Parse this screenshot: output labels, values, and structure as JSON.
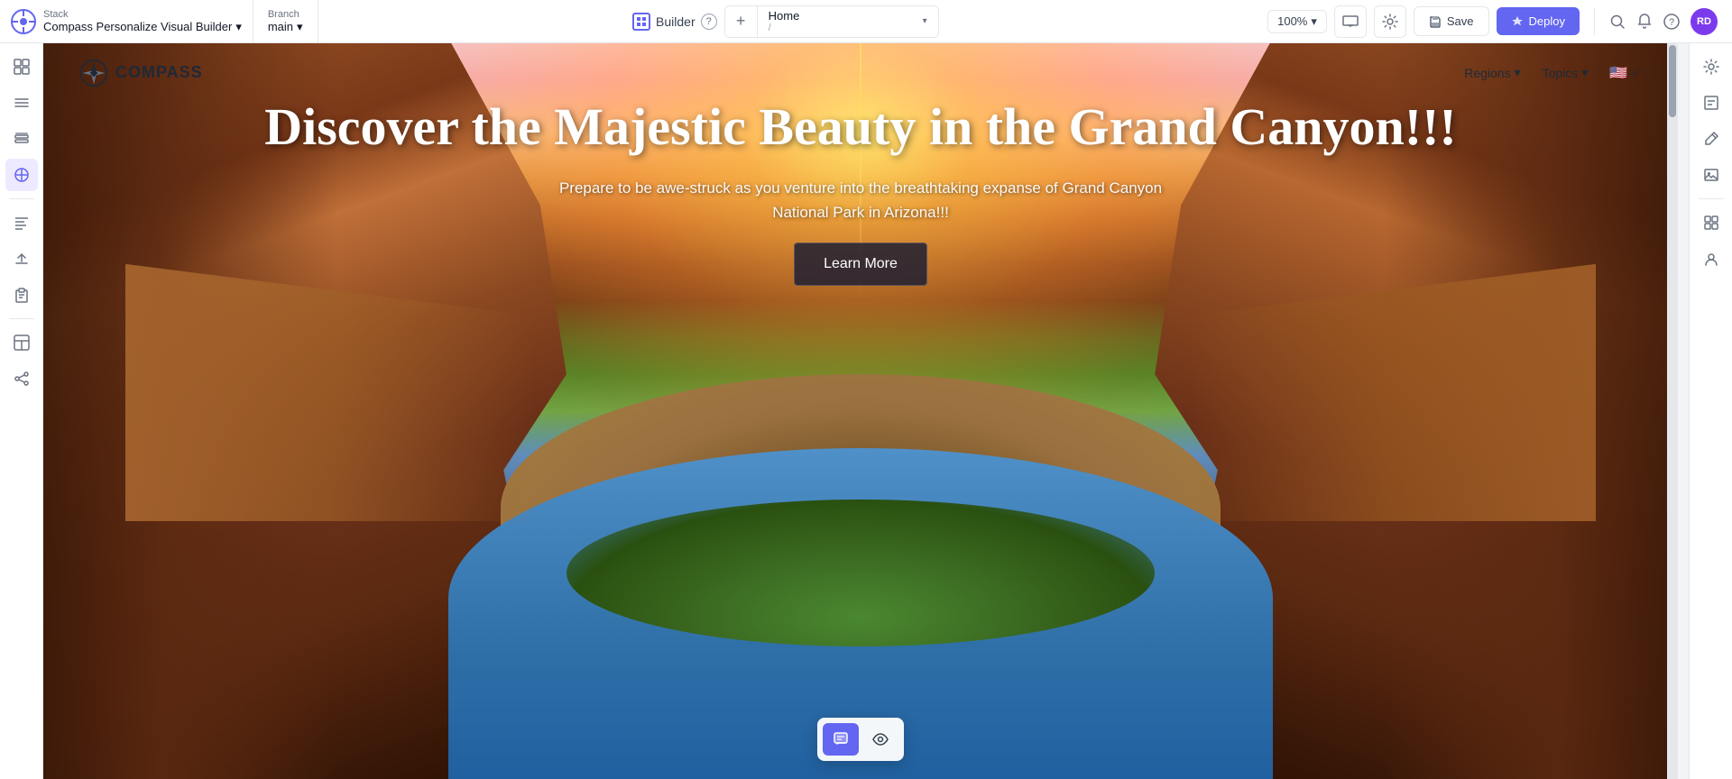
{
  "app": {
    "stack_label": "Stack",
    "stack_name": "Compass Personalize Visual Builder",
    "branch_label": "Branch",
    "branch_name": "main"
  },
  "topbar": {
    "builder_label": "Builder",
    "help_tooltip": "Help",
    "zoom_level": "100%",
    "save_label": "Save",
    "deploy_label": "Deploy",
    "avatar_initials": "RD"
  },
  "page_selector": {
    "add_label": "+",
    "page_name": "Home",
    "page_path": "/"
  },
  "site_nav": {
    "logo_text": "COMPASS",
    "regions_label": "Regions",
    "topics_label": "Topics",
    "flag_emoji": "🇺🇸"
  },
  "hero": {
    "title": "Discover the Majestic Beauty in the Grand Canyon!!!",
    "subtitle": "Prepare to be awe-struck as you venture into the breathtaking expanse of Grand Canyon National Park in Arizona!!!",
    "cta_label": "Learn More"
  },
  "left_sidebar": {
    "items": [
      {
        "name": "grid-icon",
        "symbol": "⊞",
        "active": false
      },
      {
        "name": "list-icon",
        "symbol": "≡",
        "active": false
      },
      {
        "name": "layers-icon",
        "symbol": "◧",
        "active": false
      },
      {
        "name": "components-icon",
        "symbol": "⊕",
        "active": true
      },
      {
        "name": "lines-icon",
        "symbol": "≣",
        "active": false
      },
      {
        "name": "upload-icon",
        "symbol": "↑",
        "active": false
      },
      {
        "name": "clipboard-icon",
        "symbol": "📋",
        "active": false
      },
      {
        "name": "bottom-icon",
        "symbol": "⊞",
        "active": false
      },
      {
        "name": "grid2-icon",
        "symbol": "⊟",
        "active": false
      }
    ]
  },
  "right_sidebar": {
    "items": [
      {
        "name": "settings-icon",
        "symbol": "⚙"
      },
      {
        "name": "content-icon",
        "symbol": "📄"
      },
      {
        "name": "edit-icon",
        "symbol": "✏"
      },
      {
        "name": "image-icon",
        "symbol": "🖼"
      },
      {
        "name": "component-icon",
        "symbol": "◇"
      },
      {
        "name": "user-icon",
        "symbol": "👤"
      }
    ]
  },
  "bottom_toolbar": {
    "tools": [
      {
        "name": "comment-tool",
        "active": true,
        "symbol": "💬"
      },
      {
        "name": "eye-tool",
        "active": false,
        "symbol": "👁"
      }
    ]
  }
}
